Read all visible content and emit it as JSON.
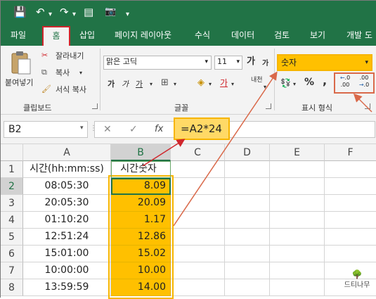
{
  "qat": {
    "save": "💾",
    "undo": "↶",
    "redo": "↷",
    "form": "▤",
    "camera": "📷",
    "more": "▾"
  },
  "tabs": [
    "파일",
    "홈",
    "삽입",
    "페이지 레이아웃",
    "수식",
    "데이터",
    "검토",
    "보기",
    "개발 도"
  ],
  "clipboard": {
    "paste": "붙여넣기",
    "cut": "잘라내기",
    "copy": "복사",
    "format_painter": "서식 복사",
    "group": "클립보드"
  },
  "font": {
    "name": "맑은 고딕",
    "size": "11",
    "grow": "가",
    "shrink": "가",
    "bold": "가",
    "italic": "가",
    "underline": "가",
    "color_a": "가",
    "wrap": "내천",
    "group": "글꼴"
  },
  "number": {
    "format": "숫자",
    "percent": "%",
    "comma": ",",
    "inc_decimal": ".00",
    "dec_decimal": ".0",
    "group": "표시 형식"
  },
  "formula_bar": {
    "namebox": "B2",
    "cancel": "✕",
    "enter": "✓",
    "fx": "fx",
    "formula": "=A2*24"
  },
  "columns": [
    "A",
    "B",
    "C",
    "D",
    "E",
    "F"
  ],
  "rows": [
    {
      "num": "1",
      "a": "시간(hh:mm:ss)",
      "b": "시간숫자"
    },
    {
      "num": "2",
      "a": "08:05:30",
      "b": "8.09"
    },
    {
      "num": "3",
      "a": "20:05:30",
      "b": "20.09"
    },
    {
      "num": "4",
      "a": "01:10:20",
      "b": "1.17"
    },
    {
      "num": "5",
      "a": "12:51:24",
      "b": "12.86"
    },
    {
      "num": "6",
      "a": "15:01:00",
      "b": "15.02"
    },
    {
      "num": "7",
      "a": "10:00:00",
      "b": "10.00"
    },
    {
      "num": "8",
      "a": "13:59:59",
      "b": "14.00"
    }
  ],
  "watermark": "드티나무",
  "colors": {
    "excel_green": "#217346",
    "highlight": "#ffc000",
    "highlight_border": "#f7b500",
    "red": "#d0262c",
    "arrow": "#d9694a"
  }
}
